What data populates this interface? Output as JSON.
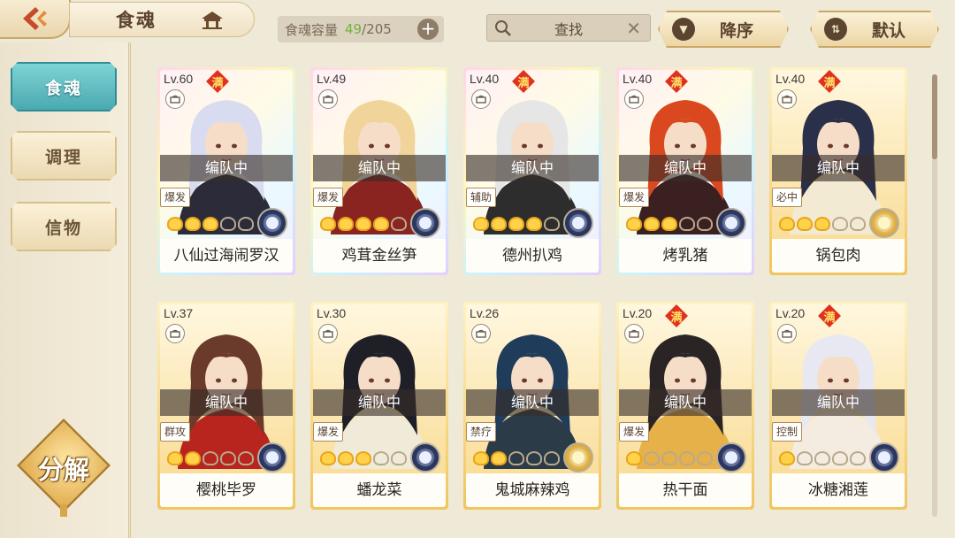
{
  "header": {
    "title": "食魂",
    "capacity_label": "食魂容量",
    "capacity_current": "49",
    "capacity_max": "/205",
    "capacity_plus": "+",
    "search_label": "查找",
    "search_clear": "✕",
    "sort_label": "降序",
    "default_label": "默认"
  },
  "sidebar": {
    "items": [
      {
        "label": "食魂",
        "active": true
      },
      {
        "label": "调理",
        "active": false
      },
      {
        "label": "信物",
        "active": false
      }
    ],
    "decompose_label": "分解"
  },
  "cards": [
    {
      "level": "Lv.60",
      "max": "满",
      "team": "编队中",
      "type": "爆发",
      "name": "八仙过海闹罗汉",
      "stars": 3,
      "frame": "rainbow",
      "element": "moon",
      "hair": "#d9dcf0",
      "coat": "#2b2b3a"
    },
    {
      "level": "Lv.49",
      "max": "",
      "team": "编队中",
      "type": "爆发",
      "name": "鸡茸金丝笋",
      "stars": 4,
      "frame": "rainbow",
      "element": "moon",
      "hair": "#f0d49a",
      "coat": "#8a2420"
    },
    {
      "level": "Lv.40",
      "max": "满",
      "team": "编队中",
      "type": "辅助",
      "name": "德州扒鸡",
      "stars": 4,
      "frame": "rainbow",
      "element": "moon",
      "hair": "#e6e6e6",
      "coat": "#2d2d2d"
    },
    {
      "level": "Lv.40",
      "max": "满",
      "team": "编队中",
      "type": "爆发",
      "name": "烤乳猪",
      "stars": 3,
      "frame": "rainbow",
      "element": "moon",
      "hair": "#d9481f",
      "coat": "#3a2020"
    },
    {
      "level": "Lv.40",
      "max": "满",
      "team": "编队中",
      "type": "必中",
      "name": "锅包肉",
      "stars": 3,
      "frame": "gold",
      "element": "sun",
      "hair": "#2a2f4a",
      "coat": "#f3ead4"
    },
    {
      "level": "Lv.37",
      "max": "",
      "team": "编队中",
      "type": "群攻",
      "name": "樱桃毕罗",
      "stars": 2,
      "frame": "gold",
      "element": "moon",
      "hair": "#6a3a2a",
      "coat": "#b8241e"
    },
    {
      "level": "Lv.30",
      "max": "",
      "team": "编队中",
      "type": "爆发",
      "name": "蟠龙菜",
      "stars": 3,
      "frame": "gold",
      "element": "moon",
      "hair": "#1f1f28",
      "coat": "#f0ead8"
    },
    {
      "level": "Lv.26",
      "max": "",
      "team": "编队中",
      "type": "禁疗",
      "name": "鬼城麻辣鸡",
      "stars": 2,
      "frame": "gold",
      "element": "sun",
      "hair": "#1f3c5a",
      "coat": "#2b3b48"
    },
    {
      "level": "Lv.20",
      "max": "满",
      "team": "编队中",
      "type": "爆发",
      "name": "热干面",
      "stars": 1,
      "frame": "gold",
      "element": "moon",
      "hair": "#2a2424",
      "coat": "#e7b14a"
    },
    {
      "level": "Lv.20",
      "max": "满",
      "team": "编队中",
      "type": "控制",
      "name": "冰糖湘莲",
      "stars": 1,
      "frame": "gold",
      "element": "moon",
      "hair": "#e8e8f2",
      "coat": "#f4ece0"
    }
  ]
}
